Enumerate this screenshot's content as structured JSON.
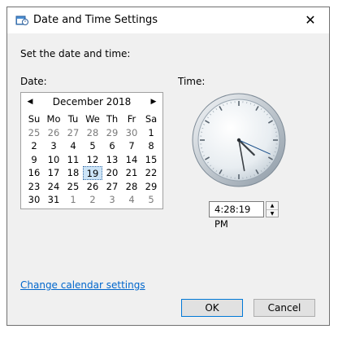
{
  "window": {
    "title": "Date and Time Settings",
    "close_glyph": "✕"
  },
  "instruction": "Set the date and time:",
  "date_label": "Date:",
  "time_label": "Time:",
  "calendar": {
    "month_year": "December 2018",
    "prev_glyph": "◀",
    "next_glyph": "▶",
    "weekdays": [
      "Su",
      "Mo",
      "Tu",
      "We",
      "Th",
      "Fr",
      "Sa"
    ],
    "weeks": [
      [
        "25",
        "26",
        "27",
        "28",
        "29",
        "30",
        "1"
      ],
      [
        "2",
        "3",
        "4",
        "5",
        "6",
        "7",
        "8"
      ],
      [
        "9",
        "10",
        "11",
        "12",
        "13",
        "14",
        "15"
      ],
      [
        "16",
        "17",
        "18",
        "19",
        "20",
        "21",
        "22"
      ],
      [
        "23",
        "24",
        "25",
        "26",
        "27",
        "28",
        "29"
      ],
      [
        "30",
        "31",
        "1",
        "2",
        "3",
        "4",
        "5"
      ]
    ],
    "selected_day": "19"
  },
  "time": {
    "value": "4:28:19 PM",
    "up_glyph": "▲",
    "down_glyph": "▼"
  },
  "change_calendar_link": "Change calendar settings",
  "buttons": {
    "ok": "OK",
    "cancel": "Cancel"
  },
  "colors": {
    "accent": "#0078d7",
    "link": "#0066cc",
    "selected": "#cce4f7"
  }
}
